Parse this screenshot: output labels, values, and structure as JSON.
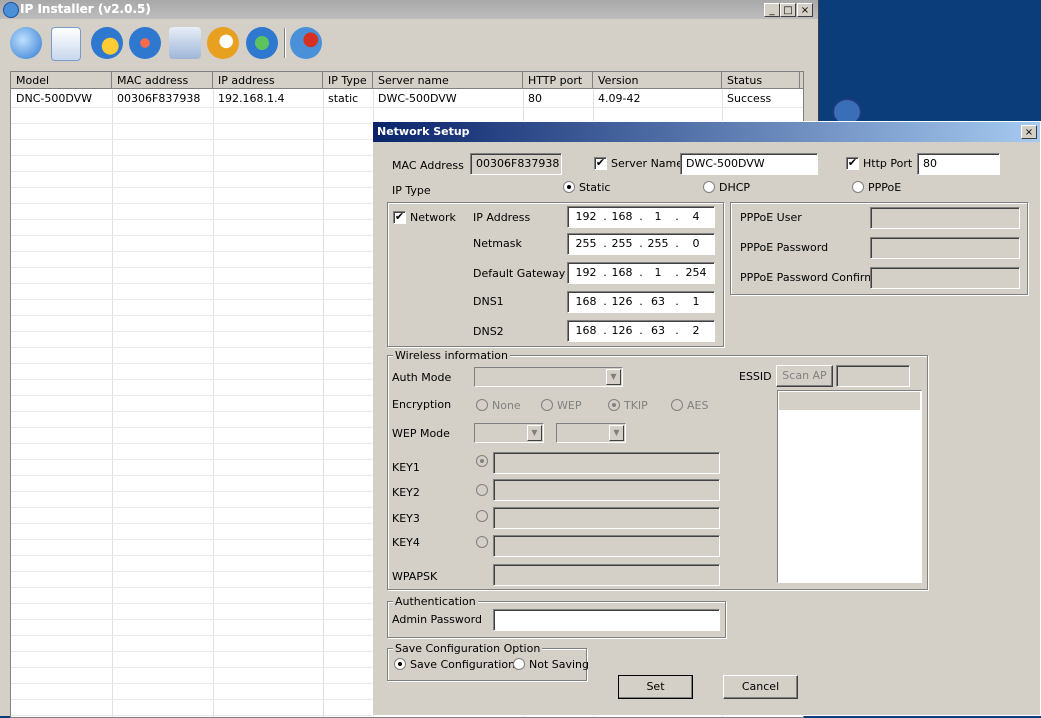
{
  "desktop": {
    "background": "#0a3d7a"
  },
  "main_window": {
    "title": "IP Installer (v2.0.5)",
    "caption_buttons": [
      "_",
      "□",
      "×"
    ],
    "toolbar_icons": [
      "search-icon",
      "refresh-icon",
      "settings-gear-icon",
      "tools-icon",
      "drive-icon",
      "camera-gear-icon",
      "upgrade-icon",
      "wrench-icon"
    ],
    "table": {
      "columns": [
        "Model",
        "MAC address",
        "IP address",
        "IP Type",
        "Server name",
        "HTTP port",
        "Version",
        "Status"
      ],
      "rows": [
        [
          "DNC-500DVW",
          "00306F837938",
          "192.168.1.4",
          "static",
          "DWC-500DVW",
          "80",
          "4.09-42",
          "Success"
        ]
      ]
    }
  },
  "dialog": {
    "title": "Network Setup",
    "close": "×",
    "mac_label": "MAC Address",
    "mac_value": "00306F837938",
    "server_name_label": "Server Name",
    "server_name_value": "DWC-500DVW",
    "http_port_label": "Http Port",
    "http_port_value": "80",
    "ip_type_label": "IP Type",
    "ip_type_options": [
      "Static",
      "DHCP",
      "PPPoE"
    ],
    "ip_type_selected": "Static",
    "network_label": "Network",
    "ip_fields": [
      {
        "label": "IP Address",
        "octets": [
          "192",
          "168",
          "1",
          "4"
        ]
      },
      {
        "label": "Netmask",
        "octets": [
          "255",
          "255",
          "255",
          "0"
        ]
      },
      {
        "label": "Default Gateway",
        "octets": [
          "192",
          "168",
          "1",
          "254"
        ]
      },
      {
        "label": "DNS1",
        "octets": [
          "168",
          "126",
          "63",
          "1"
        ]
      },
      {
        "label": "DNS2",
        "octets": [
          "168",
          "126",
          "63",
          "2"
        ]
      }
    ],
    "pppoe": {
      "user_label": "PPPoE User",
      "password_label": "PPPoE Password",
      "confirm_label": "PPPoE Password Confirm"
    },
    "wireless": {
      "legend": "Wireless information",
      "auth_mode_label": "Auth Mode",
      "encryption_label": "Encryption",
      "encryption_options": [
        "None",
        "WEP",
        "TKIP",
        "AES"
      ],
      "encryption_selected": "TKIP",
      "wep_mode_label": "WEP Mode",
      "keys": [
        "KEY1",
        "KEY2",
        "KEY3",
        "KEY4"
      ],
      "wpapsk_label": "WPAPSK",
      "essid_label": "ESSID",
      "scan_ap_label": "Scan AP"
    },
    "authentication": {
      "legend": "Authentication",
      "admin_password_label": "Admin Password"
    },
    "save_option": {
      "legend": "Save Configuration Option",
      "save_label": "Save Configuration",
      "not_saving_label": "Not Saving",
      "selected": "Save Configuration"
    },
    "set_label": "Set",
    "cancel_label": "Cancel"
  }
}
